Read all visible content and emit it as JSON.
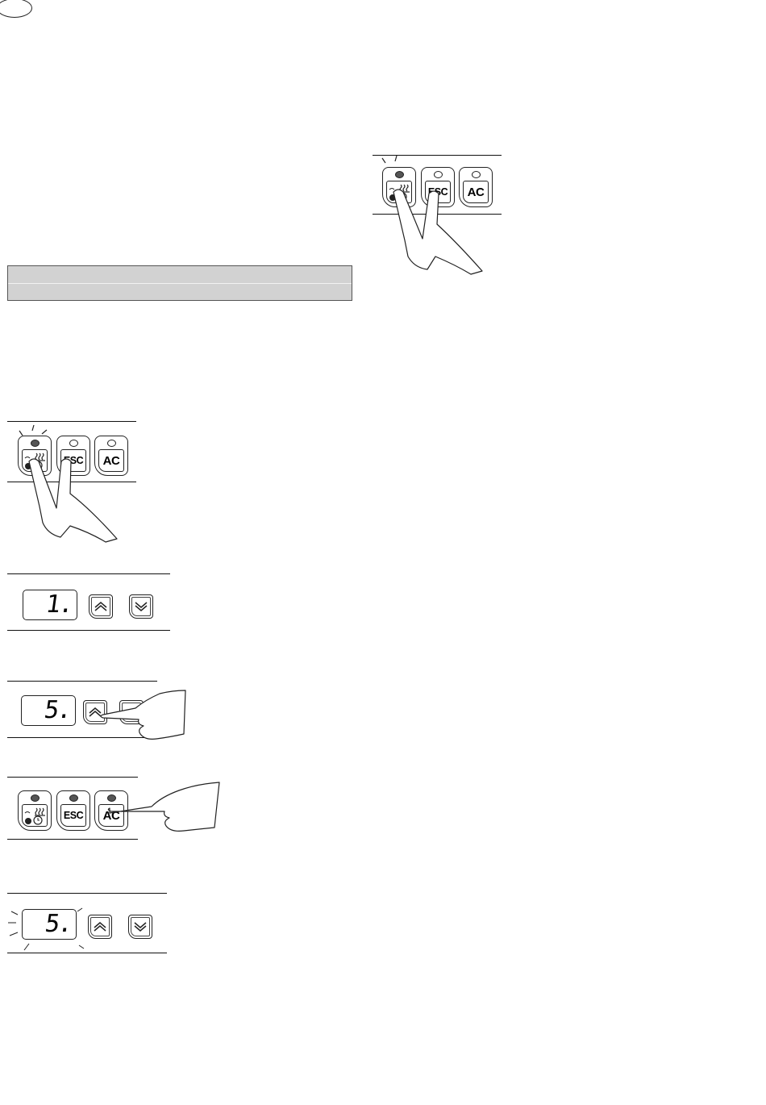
{
  "figures": {
    "fig_top": {
      "keys": [
        {
          "id": "program",
          "label": "",
          "led": "on"
        },
        {
          "id": "esc",
          "label": "ESC",
          "led": "off"
        },
        {
          "id": "ac",
          "label": "AC",
          "led": "off"
        }
      ]
    },
    "fig_a": {
      "keys": [
        {
          "id": "program",
          "label": "",
          "led": "on"
        },
        {
          "id": "esc",
          "label": "ESC",
          "led": "off"
        },
        {
          "id": "ac",
          "label": "AC",
          "led": "off"
        }
      ]
    },
    "fig_b": {
      "display": "1.",
      "up_icon": "chevron-up-icon",
      "down_icon": "chevron-down-icon"
    },
    "fig_c": {
      "display": "5.",
      "up_icon": "chevron-up-icon",
      "down_icon": "chevron-down-icon"
    },
    "fig_d": {
      "keys": [
        {
          "id": "program",
          "label": "",
          "led": "on"
        },
        {
          "id": "esc",
          "label": "ESC",
          "led": "on"
        },
        {
          "id": "ac",
          "label": "AC",
          "led": "on"
        }
      ]
    },
    "fig_e": {
      "display": "5.",
      "blinking": true,
      "up_icon": "chevron-up-icon",
      "down_icon": "chevron-down-icon"
    }
  },
  "colors": {
    "band": "#d2d2d2",
    "line": "#111111"
  }
}
